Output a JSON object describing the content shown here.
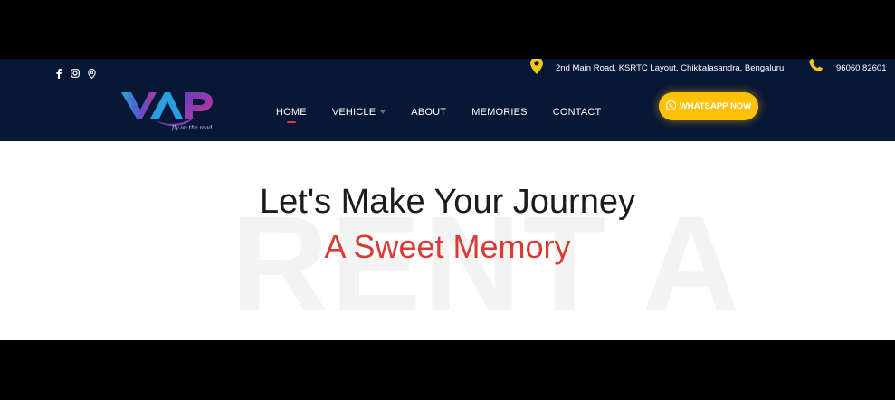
{
  "topbar": {
    "social": [
      {
        "icon": "facebook-icon",
        "glyph": "f"
      },
      {
        "icon": "instagram-icon"
      },
      {
        "icon": "map-pin-icon"
      }
    ],
    "address": {
      "icon": "location-pin-icon",
      "text": "2nd Main Road, KSRTC Layout, Chikkalasandra, Bengaluru"
    },
    "phone": {
      "icon": "phone-icon",
      "text": "96060 82601"
    }
  },
  "logo": {
    "letters": "VAP",
    "tagline": "fly on the road"
  },
  "nav": {
    "items": [
      {
        "label": "HOME",
        "active": true
      },
      {
        "label": "VEHICLE",
        "dropdown": true
      },
      {
        "label": "ABOUT"
      },
      {
        "label": "MEMORIES"
      },
      {
        "label": "CONTACT"
      }
    ]
  },
  "cta": {
    "label": "WHATSAPP NOW",
    "icon": "whatsapp-icon"
  },
  "hero": {
    "title": "Let's Make Your Journey",
    "subtitle": "A Sweet Memory",
    "watermark": "RENT A"
  },
  "colors": {
    "header_bg": "#081735",
    "accent_yellow": "#ffc107",
    "accent_red": "#d93a34",
    "nav_underline": "#e53935"
  }
}
